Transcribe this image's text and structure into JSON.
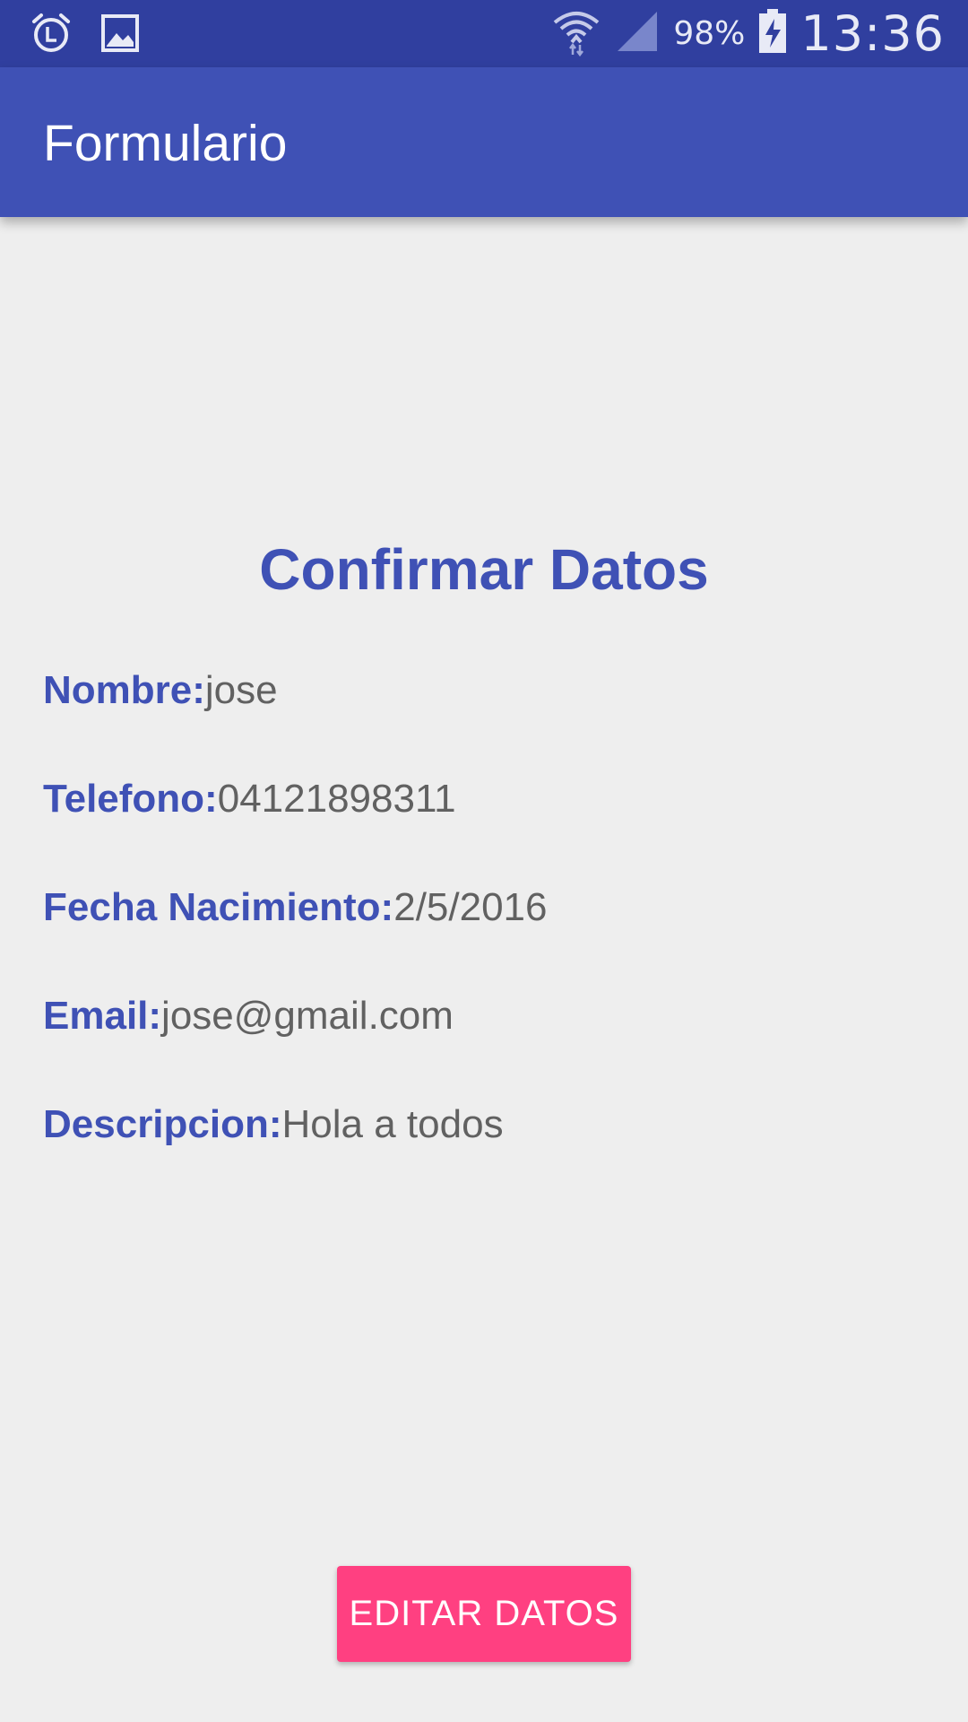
{
  "status_bar": {
    "left_icons": [
      "alarm-icon",
      "image-icon"
    ],
    "right_icons": [
      "wifi-icon",
      "signal-icon",
      "battery-charging-icon"
    ],
    "battery_percent": "98%",
    "time": "13:36",
    "background_color": "#303F9F"
  },
  "app_bar": {
    "title": "Formulario",
    "background_color": "#3F51B5"
  },
  "main": {
    "title": "Confirmar Datos",
    "fields": [
      {
        "label": "Nombre:",
        "value": "jose"
      },
      {
        "label": "Telefono:",
        "value": "04121898311"
      },
      {
        "label": "Fecha Nacimiento:",
        "value": "2/5/2016"
      },
      {
        "label": "Email:",
        "value": "jose@gmail.com"
      },
      {
        "label": "Descripcion:",
        "value": "Hola a todos"
      }
    ],
    "label_color": "#3F51B5",
    "value_color": "#616161"
  },
  "actions": {
    "edit_label": "EDITAR DATOS",
    "button_color": "#FF4081"
  }
}
